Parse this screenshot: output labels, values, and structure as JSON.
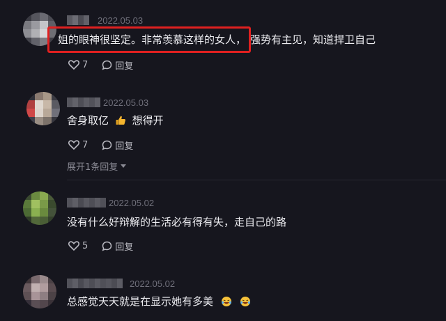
{
  "comments": [
    {
      "date": "2022.05.03",
      "text_part1": "姐的眼神很坚定。非常羡慕这样的女人，",
      "text_part2": "强势有主见，知道捍卫自己",
      "likes": "7",
      "reply_label": "回复"
    },
    {
      "date": "2022.05.03",
      "text_part1": "舍身取亿",
      "text_part2": "想得开",
      "likes": "7",
      "reply_label": "回复",
      "expand_label": "展开1条回复"
    },
    {
      "date": "2022.05.02",
      "text_part1": "没有什么好辩解的生活必有得有失，走自己的路",
      "likes": "5",
      "reply_label": "回复"
    },
    {
      "date": "2022.05.02",
      "text_part1": "总感觉天天就是在显示她有多美"
    }
  ],
  "icons": {
    "like": "heart-icon",
    "reply": "reply-bubble-icon",
    "thumbs_up": "thumbs-up-emoji",
    "laugh": "laughing-emoji"
  },
  "colors": {
    "background": "#16161e",
    "highlight": "#e02020",
    "date_text": "#6f6f7a"
  }
}
